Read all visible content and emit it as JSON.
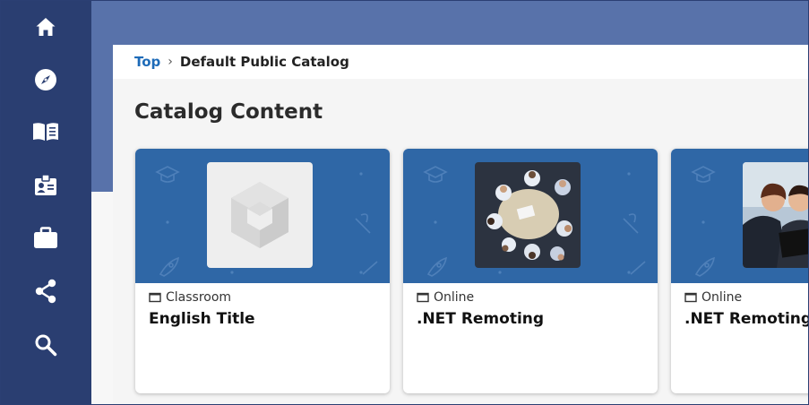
{
  "sidebar": {
    "items": [
      {
        "icon": "home-icon"
      },
      {
        "icon": "compass-icon"
      },
      {
        "icon": "book-icon"
      },
      {
        "icon": "id-badge-icon"
      },
      {
        "icon": "briefcase-icon"
      },
      {
        "icon": "share-icon"
      },
      {
        "icon": "search-icon"
      }
    ]
  },
  "breadcrumb": {
    "top_label": "Top",
    "separator": "›",
    "current_label": "Default Public Catalog"
  },
  "page": {
    "title": "Catalog Content"
  },
  "cards": [
    {
      "type_label": "Classroom",
      "title": "English Title",
      "thumbnail": "placeholder-logo"
    },
    {
      "type_label": "Online",
      "title": ".NET Remoting",
      "thumbnail": "meeting-photo"
    },
    {
      "type_label": "Online",
      "title": ".NET Remoting i",
      "thumbnail": "people-photo"
    }
  ],
  "colors": {
    "sidebar": "#2a3e71",
    "hero": "#5872aa",
    "card_banner": "#2f67a6",
    "link": "#1e6bb8"
  }
}
